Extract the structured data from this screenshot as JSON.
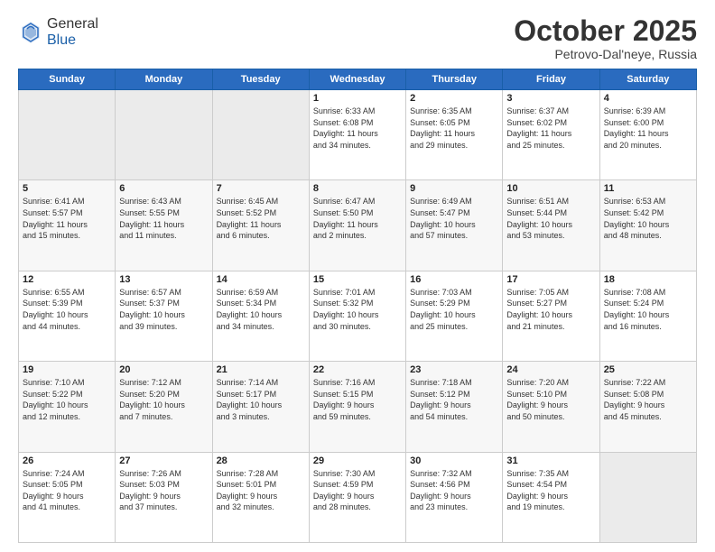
{
  "header": {
    "logo_general": "General",
    "logo_blue": "Blue",
    "month_title": "October 2025",
    "location": "Petrovo-Dal'neye, Russia"
  },
  "days_of_week": [
    "Sunday",
    "Monday",
    "Tuesday",
    "Wednesday",
    "Thursday",
    "Friday",
    "Saturday"
  ],
  "weeks": [
    [
      {
        "day": "",
        "info": ""
      },
      {
        "day": "",
        "info": ""
      },
      {
        "day": "",
        "info": ""
      },
      {
        "day": "1",
        "info": "Sunrise: 6:33 AM\nSunset: 6:08 PM\nDaylight: 11 hours\nand 34 minutes."
      },
      {
        "day": "2",
        "info": "Sunrise: 6:35 AM\nSunset: 6:05 PM\nDaylight: 11 hours\nand 29 minutes."
      },
      {
        "day": "3",
        "info": "Sunrise: 6:37 AM\nSunset: 6:02 PM\nDaylight: 11 hours\nand 25 minutes."
      },
      {
        "day": "4",
        "info": "Sunrise: 6:39 AM\nSunset: 6:00 PM\nDaylight: 11 hours\nand 20 minutes."
      }
    ],
    [
      {
        "day": "5",
        "info": "Sunrise: 6:41 AM\nSunset: 5:57 PM\nDaylight: 11 hours\nand 15 minutes."
      },
      {
        "day": "6",
        "info": "Sunrise: 6:43 AM\nSunset: 5:55 PM\nDaylight: 11 hours\nand 11 minutes."
      },
      {
        "day": "7",
        "info": "Sunrise: 6:45 AM\nSunset: 5:52 PM\nDaylight: 11 hours\nand 6 minutes."
      },
      {
        "day": "8",
        "info": "Sunrise: 6:47 AM\nSunset: 5:50 PM\nDaylight: 11 hours\nand 2 minutes."
      },
      {
        "day": "9",
        "info": "Sunrise: 6:49 AM\nSunset: 5:47 PM\nDaylight: 10 hours\nand 57 minutes."
      },
      {
        "day": "10",
        "info": "Sunrise: 6:51 AM\nSunset: 5:44 PM\nDaylight: 10 hours\nand 53 minutes."
      },
      {
        "day": "11",
        "info": "Sunrise: 6:53 AM\nSunset: 5:42 PM\nDaylight: 10 hours\nand 48 minutes."
      }
    ],
    [
      {
        "day": "12",
        "info": "Sunrise: 6:55 AM\nSunset: 5:39 PM\nDaylight: 10 hours\nand 44 minutes."
      },
      {
        "day": "13",
        "info": "Sunrise: 6:57 AM\nSunset: 5:37 PM\nDaylight: 10 hours\nand 39 minutes."
      },
      {
        "day": "14",
        "info": "Sunrise: 6:59 AM\nSunset: 5:34 PM\nDaylight: 10 hours\nand 34 minutes."
      },
      {
        "day": "15",
        "info": "Sunrise: 7:01 AM\nSunset: 5:32 PM\nDaylight: 10 hours\nand 30 minutes."
      },
      {
        "day": "16",
        "info": "Sunrise: 7:03 AM\nSunset: 5:29 PM\nDaylight: 10 hours\nand 25 minutes."
      },
      {
        "day": "17",
        "info": "Sunrise: 7:05 AM\nSunset: 5:27 PM\nDaylight: 10 hours\nand 21 minutes."
      },
      {
        "day": "18",
        "info": "Sunrise: 7:08 AM\nSunset: 5:24 PM\nDaylight: 10 hours\nand 16 minutes."
      }
    ],
    [
      {
        "day": "19",
        "info": "Sunrise: 7:10 AM\nSunset: 5:22 PM\nDaylight: 10 hours\nand 12 minutes."
      },
      {
        "day": "20",
        "info": "Sunrise: 7:12 AM\nSunset: 5:20 PM\nDaylight: 10 hours\nand 7 minutes."
      },
      {
        "day": "21",
        "info": "Sunrise: 7:14 AM\nSunset: 5:17 PM\nDaylight: 10 hours\nand 3 minutes."
      },
      {
        "day": "22",
        "info": "Sunrise: 7:16 AM\nSunset: 5:15 PM\nDaylight: 9 hours\nand 59 minutes."
      },
      {
        "day": "23",
        "info": "Sunrise: 7:18 AM\nSunset: 5:12 PM\nDaylight: 9 hours\nand 54 minutes."
      },
      {
        "day": "24",
        "info": "Sunrise: 7:20 AM\nSunset: 5:10 PM\nDaylight: 9 hours\nand 50 minutes."
      },
      {
        "day": "25",
        "info": "Sunrise: 7:22 AM\nSunset: 5:08 PM\nDaylight: 9 hours\nand 45 minutes."
      }
    ],
    [
      {
        "day": "26",
        "info": "Sunrise: 7:24 AM\nSunset: 5:05 PM\nDaylight: 9 hours\nand 41 minutes."
      },
      {
        "day": "27",
        "info": "Sunrise: 7:26 AM\nSunset: 5:03 PM\nDaylight: 9 hours\nand 37 minutes."
      },
      {
        "day": "28",
        "info": "Sunrise: 7:28 AM\nSunset: 5:01 PM\nDaylight: 9 hours\nand 32 minutes."
      },
      {
        "day": "29",
        "info": "Sunrise: 7:30 AM\nSunset: 4:59 PM\nDaylight: 9 hours\nand 28 minutes."
      },
      {
        "day": "30",
        "info": "Sunrise: 7:32 AM\nSunset: 4:56 PM\nDaylight: 9 hours\nand 23 minutes."
      },
      {
        "day": "31",
        "info": "Sunrise: 7:35 AM\nSunset: 4:54 PM\nDaylight: 9 hours\nand 19 minutes."
      },
      {
        "day": "",
        "info": ""
      }
    ]
  ]
}
